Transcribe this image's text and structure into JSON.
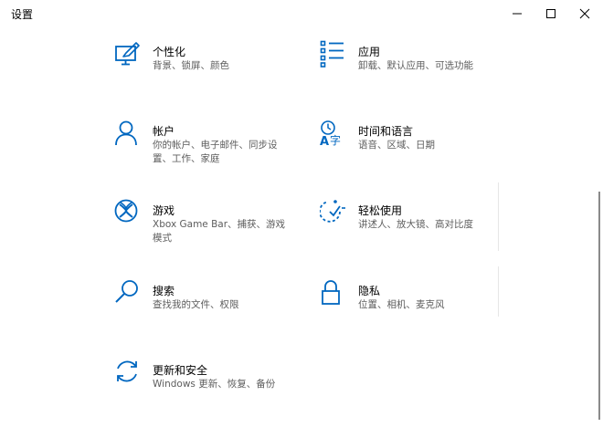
{
  "window": {
    "title": "设置",
    "accent_color": "#0067c0"
  },
  "window_controls": {
    "minimize_icon": "minimize-icon",
    "maximize_icon": "maximize-icon",
    "close_icon": "close-icon"
  },
  "categories": [
    {
      "name": "个性化",
      "desc": "背景、锁屏、颜色",
      "icon": "personalization-icon"
    },
    {
      "name": "应用",
      "desc": "卸载、默认应用、可选功能",
      "icon": "apps-icon"
    },
    {
      "name": "帐户",
      "desc": "你的帐户、电子邮件、同步设置、工作、家庭",
      "icon": "accounts-icon"
    },
    {
      "name": "时间和语言",
      "desc": "语音、区域、日期",
      "icon": "time-language-icon"
    },
    {
      "name": "游戏",
      "desc": "Xbox Game Bar、捕获、游戏模式",
      "icon": "gaming-icon"
    },
    {
      "name": "轻松使用",
      "desc": "讲述人、放大镜、高对比度",
      "icon": "ease-of-access-icon"
    },
    {
      "name": "搜索",
      "desc": "查找我的文件、权限",
      "icon": "search-icon"
    },
    {
      "name": "隐私",
      "desc": "位置、相机、麦克风",
      "icon": "privacy-lock-icon"
    },
    {
      "name": "更新和安全",
      "desc": "Windows 更新、恢复、备份",
      "icon": "update-security-icon"
    }
  ]
}
